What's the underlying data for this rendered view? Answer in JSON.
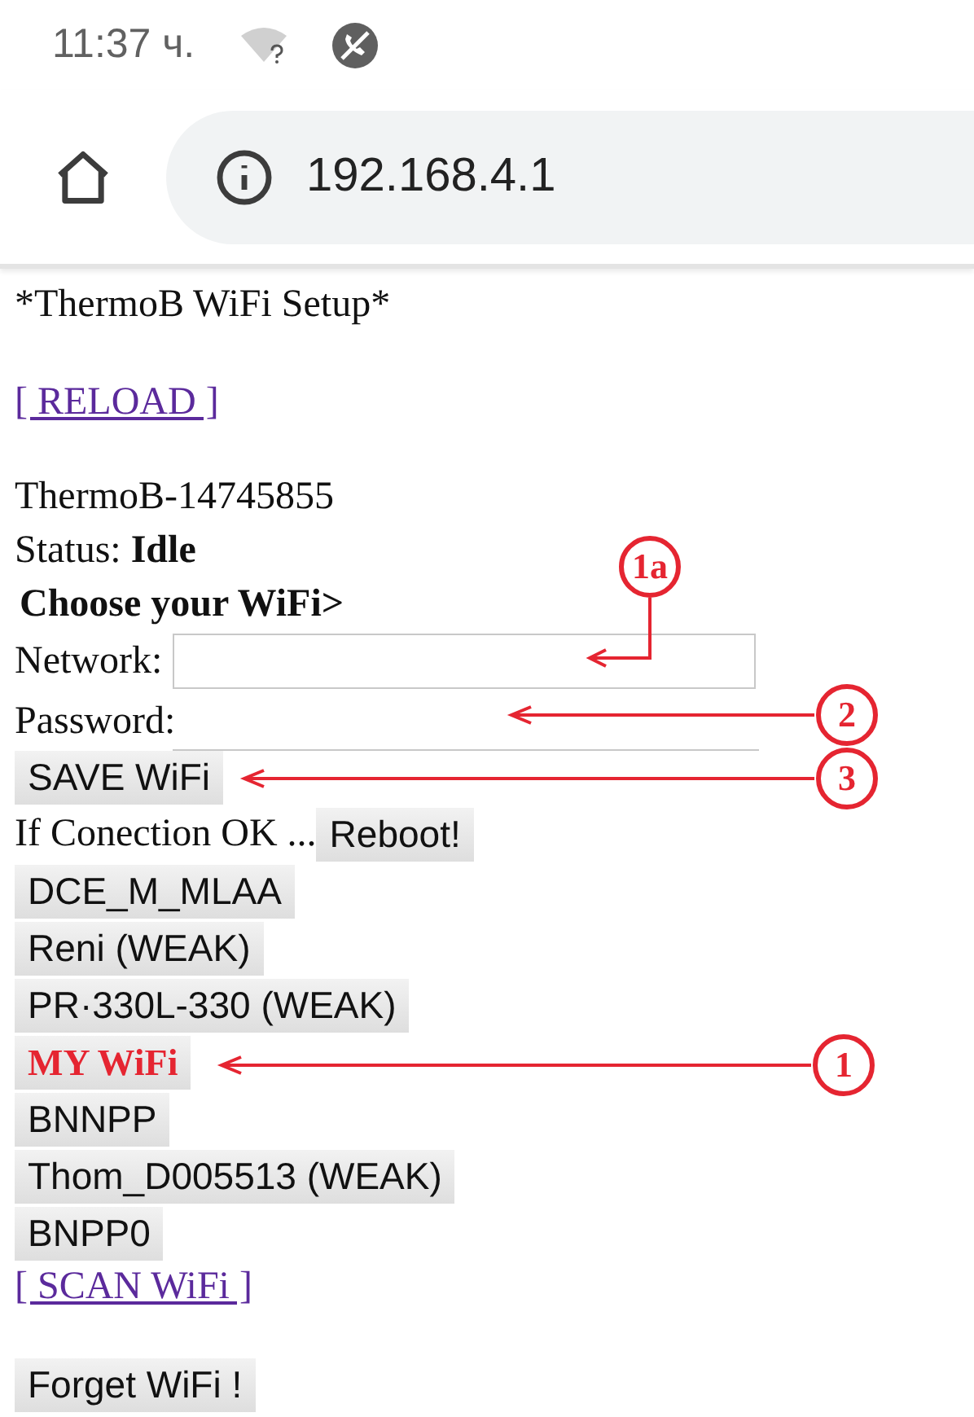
{
  "status_bar": {
    "time": "11:37 ч."
  },
  "address_bar": {
    "url": "192.168.4.1"
  },
  "page": {
    "title": "*ThermoB WiFi Setup*",
    "reload_link": "[ RELOAD ]",
    "device": "ThermoB-14745855",
    "status_label": "Status:",
    "status_value": "Idle",
    "choose_heading": "Choose your WiFi>",
    "network_label": "Network:",
    "password_label": "Password:",
    "save_button": "SAVE WiFi",
    "reboot_text": "If Conection OK ...",
    "reboot_button": "Reboot!",
    "networks": [
      {
        "name": "DCE_M_MLAA",
        "highlighted": false
      },
      {
        "name": "Reni (WEAK)",
        "highlighted": false
      },
      {
        "name": "PR·330L-330 (WEAK)",
        "highlighted": false
      },
      {
        "name": "MY WiFi",
        "highlighted": true
      },
      {
        "name": "BNNPP",
        "highlighted": false
      },
      {
        "name": "Thom_D005513 (WEAK)",
        "highlighted": false
      },
      {
        "name": "BNPP0",
        "highlighted": false
      }
    ],
    "scan_link": "[ SCAN WiFi ]",
    "forget_button": "Forget WiFi !"
  },
  "annotations": [
    {
      "label": "1a"
    },
    {
      "label": "2"
    },
    {
      "label": "3"
    },
    {
      "label": "1"
    }
  ]
}
